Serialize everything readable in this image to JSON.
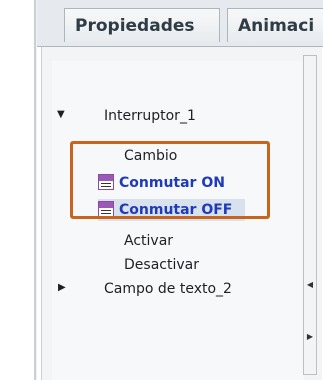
{
  "tabs": {
    "properties": "Propiedades",
    "animations": "Animaci"
  },
  "tree": {
    "interruptor": "Interruptor_1",
    "cambio": "Cambio",
    "conmutar_on": "Conmutar ON",
    "conmutar_off": "Conmutar OFF",
    "activar": "Activar",
    "desactivar": "Desactivar",
    "campo_texto": "Campo de texto_2"
  },
  "icons": {
    "expand": "triangle-down",
    "collapse": "triangle-right",
    "function_block": "function-block-icon"
  },
  "colors": {
    "highlight_border": "#c8641c",
    "selected_text": "#1f3bb8"
  }
}
